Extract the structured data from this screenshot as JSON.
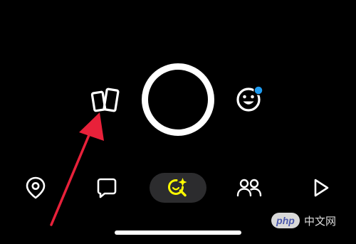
{
  "camera_controls": {
    "memories_icon": "memories-cards-icon",
    "capture_icon": "shutter-ring-icon",
    "lens_icon": "smiley-lens-icon",
    "lens_notification_color": "#1e9bf0"
  },
  "annotation": {
    "arrow_color": "#e8213a",
    "arrow_target": "memories-button"
  },
  "bottom_nav": {
    "items": [
      {
        "icon": "map-pin-icon",
        "selected": false
      },
      {
        "icon": "chat-bubble-icon",
        "selected": false
      },
      {
        "icon": "camera-sparkle-search-icon",
        "selected": true,
        "accent": "#fffc00"
      },
      {
        "icon": "friends-icon",
        "selected": false
      },
      {
        "icon": "play-icon",
        "selected": false
      }
    ]
  },
  "watermark": {
    "badge": "php",
    "text": "中文网"
  }
}
